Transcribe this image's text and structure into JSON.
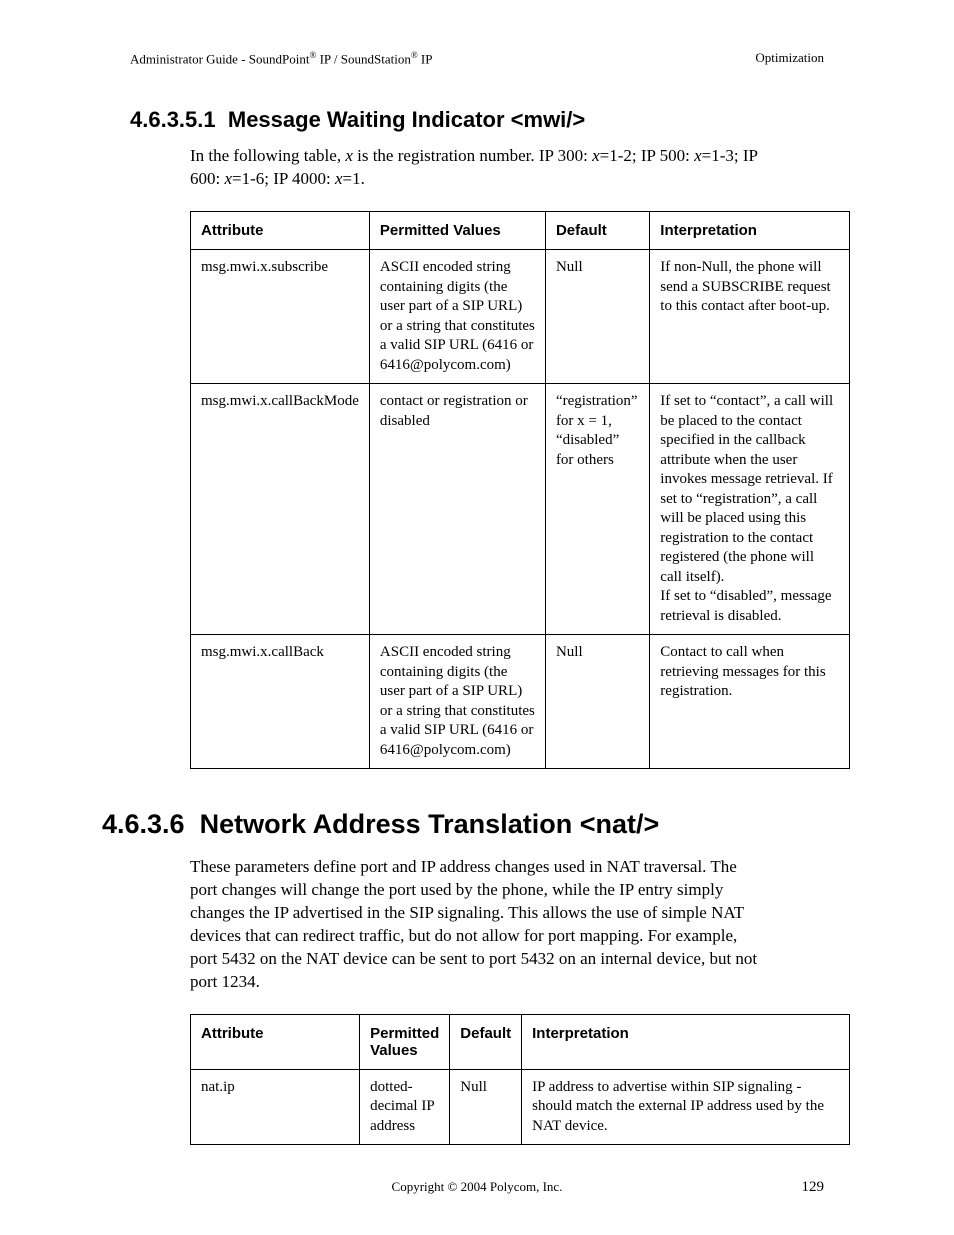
{
  "header": {
    "left_prefix": "Administrator Guide - SoundPoint",
    "left_mid": " IP / SoundStation",
    "left_suffix": " IP",
    "right": "Optimization"
  },
  "section1": {
    "number": "4.6.3.5.1",
    "title": "Message Waiting Indicator <mwi/>",
    "intro_a": "In the following table, ",
    "intro_x": "x",
    "intro_b": " is the registration number.  IP 300: ",
    "intro_c": "=1-2; IP 500: ",
    "intro_d": "=1-3; IP 600: ",
    "intro_e": "=1-6; IP 4000: ",
    "intro_f": "=1."
  },
  "table1": {
    "headers": [
      "Attribute",
      "Permitted Values",
      "Default",
      "Interpretation"
    ],
    "rows": [
      {
        "attr": "msg.mwi.x.subscribe",
        "perm": "ASCII encoded string containing digits (the user part of a SIP URL) or a string that constitutes a valid SIP URL (6416 or 6416@polycom.com)",
        "def": "Null",
        "interp": "If non-Null, the phone will send a SUBSCRIBE request to this contact after boot-up."
      },
      {
        "attr": "msg.mwi.x.callBackMode",
        "perm": "contact or registration or disabled",
        "def": "“registration” for x = 1, “disabled” for others",
        "interp": "If set to “contact”, a call will be placed to the contact specified in the callback attribute when the user invokes message retrieval. If set to “registration”, a call will be placed using this registration to the contact registered (the phone will call itself).\nIf set to “disabled”, message retrieval is disabled."
      },
      {
        "attr": "msg.mwi.x.callBack",
        "perm": "ASCII encoded string containing digits (the user part of a SIP URL) or a string that constitutes a valid SIP URL (6416 or 6416@polycom.com)",
        "def": "Null",
        "interp": "Contact to call when retrieving messages for this registration."
      }
    ]
  },
  "section2": {
    "number": "4.6.3.6",
    "title": "Network Address Translation <nat/>",
    "body": "These parameters define port and IP address changes used in NAT traversal.  The port changes will change the port used by the phone, while the IP entry simply changes the IP advertised in the SIP signaling.  This allows the use of simple NAT devices that can redirect traffic, but do not allow for port mapping.  For example, port 5432 on the NAT device can be sent to port 5432 on an internal device, but not port 1234."
  },
  "table2": {
    "headers": [
      "Attribute",
      "Permitted Values",
      "Default",
      "Interpretation"
    ],
    "rows": [
      {
        "attr": "nat.ip",
        "perm": "dotted-decimal IP address",
        "def": "Null",
        "interp": "IP address to advertise within SIP signaling - should match the external IP address used by the NAT device."
      }
    ]
  },
  "footer": {
    "copyright": "Copyright © 2004 Polycom, Inc.",
    "page": "129"
  }
}
